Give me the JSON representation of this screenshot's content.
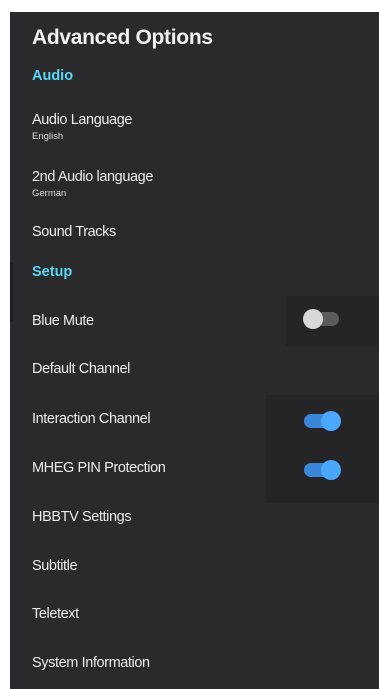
{
  "title": "Advanced Options",
  "sections": {
    "audio": "Audio",
    "setup": "Setup"
  },
  "items": {
    "audio_language": {
      "label": "Audio Language",
      "value": "English"
    },
    "second_audio": {
      "label": "2nd Audio language",
      "value": "German"
    },
    "sound_tracks": {
      "label": "Sound Tracks"
    },
    "blue_mute": {
      "label": "Blue Mute",
      "toggle": "off"
    },
    "default_channel": {
      "label": "Default Channel"
    },
    "interaction_channel": {
      "label": "Interaction Channel",
      "toggle": "on"
    },
    "mheg_pin": {
      "label": "MHEG PIN Protection",
      "toggle": "on"
    },
    "hbbtv": {
      "label": "HBBTV Settings"
    },
    "subtitle": {
      "label": "Subtitle"
    },
    "teletext": {
      "label": "Teletext"
    },
    "system_info": {
      "label": "System Information"
    }
  },
  "colors": {
    "panel_bg": "#2a2a2c",
    "section_accent": "#5cd6f2",
    "toggle_on": "#4aa8ff",
    "toggle_off": "#d8d8d8"
  }
}
